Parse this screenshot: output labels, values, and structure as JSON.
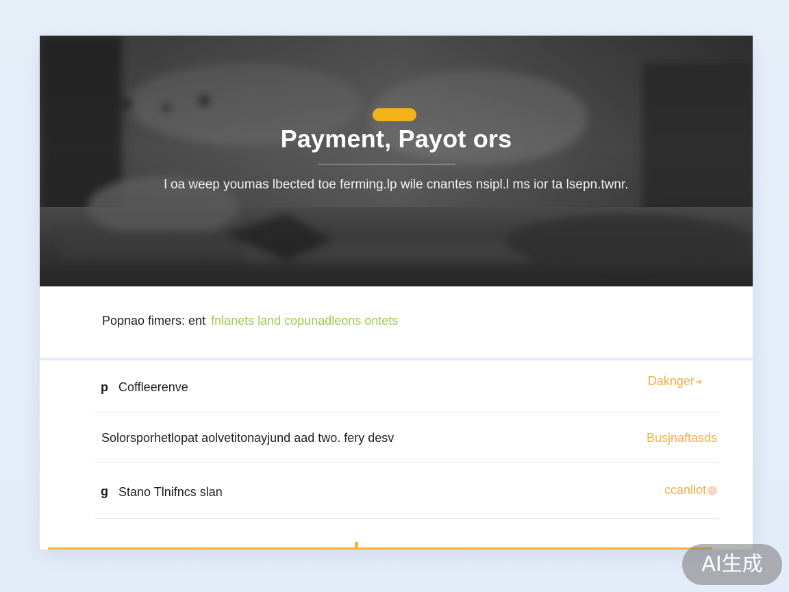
{
  "hero": {
    "title": "Payment, Payot ors",
    "subtitle": "l oa weep youmas  lbected toe ferming.lp wile cnantes nsipl.l ms ior ta lsepn.twnr."
  },
  "intro": {
    "prefix": "Popnao fimers: ent",
    "accent": "fnlanets land copunadleons ontets"
  },
  "rows": [
    {
      "icon": "p",
      "label": "Coffleerenve",
      "action": "Daknger"
    },
    {
      "icon": "",
      "label": "Solorsporhetlopat aolvetitonayjund aad two. fery desv",
      "action": "Busjnaftasds"
    },
    {
      "icon": "g",
      "label": "Stano Tlnifncs slan",
      "action": "ccanllot"
    }
  ],
  "watermark": "AI生成",
  "colors": {
    "accent": "#f4b21b",
    "link": "#f2b046",
    "green": "#9ccc4c"
  }
}
